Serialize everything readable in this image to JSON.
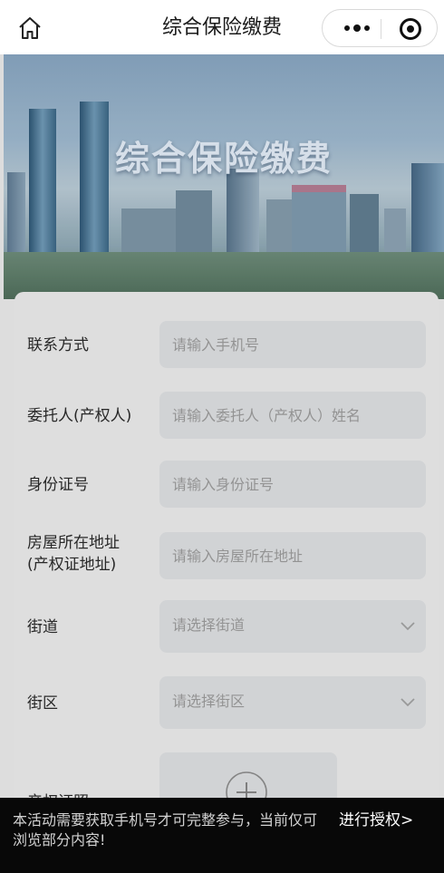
{
  "nav": {
    "title": "综合保险缴费",
    "home_icon": "home-icon",
    "more_icon": "more-dots-icon",
    "close_icon": "mini-program-close-icon"
  },
  "banner": {
    "title": "综合保险缴费"
  },
  "form": {
    "contact": {
      "label": "联系方式",
      "placeholder": "请输入手机号"
    },
    "client": {
      "label": "委托人(产权人)",
      "placeholder": "请输入委托人（产权人）姓名"
    },
    "id_number": {
      "label": "身份证号",
      "placeholder": "请输入身份证号"
    },
    "address": {
      "label_line1": "房屋所在地址",
      "label_line2": "(产权证地址)",
      "placeholder": "请输入房屋所在地址"
    },
    "street": {
      "label": "街道",
      "placeholder": "请选择街道"
    },
    "district": {
      "label": "街区",
      "placeholder": "请选择街区"
    },
    "certificate": {
      "label": "产权证照"
    }
  },
  "bottom_bar": {
    "message": "本活动需要获取手机号才可完整参与，当前仅可浏览部分内容!",
    "action": "进行授权>"
  },
  "colors": {
    "field_bg": "#dadcde",
    "card_bg": "#e8e8e8",
    "bottom_bar_bg": "#080808"
  }
}
